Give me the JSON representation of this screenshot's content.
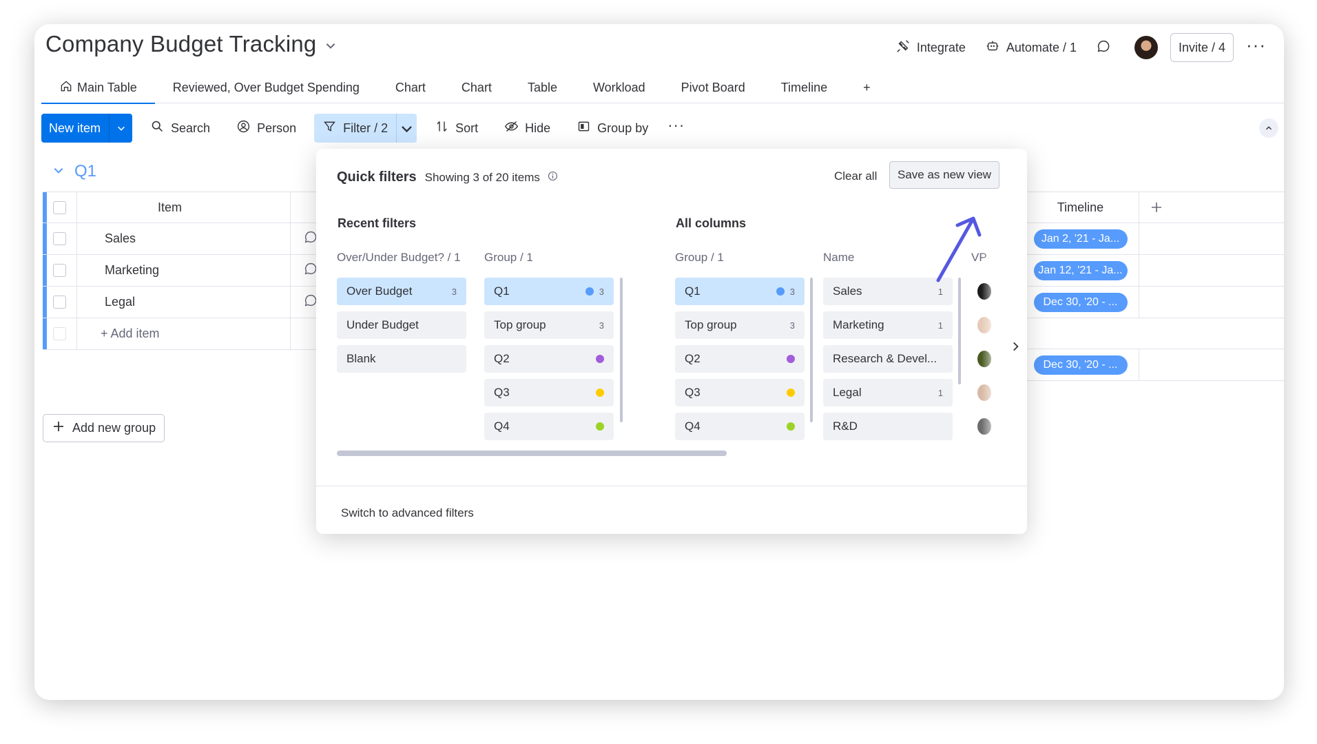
{
  "board": {
    "title": "Company Budget Tracking"
  },
  "header": {
    "integrate": "Integrate",
    "automate": "Automate / 1",
    "invite": "Invite / 4"
  },
  "tabs": [
    {
      "label": "Main Table",
      "icon": "home-icon",
      "active": true
    },
    {
      "label": "Reviewed, Over Budget Spending"
    },
    {
      "label": "Chart"
    },
    {
      "label": "Chart"
    },
    {
      "label": "Table"
    },
    {
      "label": "Workload"
    },
    {
      "label": "Pivot Board"
    },
    {
      "label": "Timeline"
    },
    {
      "label": "+"
    }
  ],
  "toolbar": {
    "new_item": "New item",
    "search": "Search",
    "person": "Person",
    "filter": "Filter / 2",
    "sort": "Sort",
    "hide": "Hide",
    "group_by": "Group by"
  },
  "group": {
    "title": "Q1",
    "item_header": "Item",
    "timeline_header": "Timeline",
    "rows": [
      {
        "name": "Sales",
        "timeline": "Jan 2, '21 - Ja..."
      },
      {
        "name": "Marketing",
        "timeline": "Jan 12, '21 - Ja..."
      },
      {
        "name": "Legal",
        "timeline": "Dec 30, '20 - ..."
      }
    ],
    "add_item": "+ Add item",
    "extra_timeline": "Dec 30, '20 - ..."
  },
  "add_group": "Add new group",
  "filter_popover": {
    "title": "Quick filters",
    "showing": "Showing 3 of 20 items",
    "clear_all": "Clear all",
    "save_view": "Save as new view",
    "recent_title": "Recent filters",
    "all_title": "All columns",
    "switch_advanced": "Switch to advanced filters",
    "recent_columns": [
      {
        "title": "Over/Under Budget? / 1",
        "options": [
          {
            "label": "Over Budget",
            "count": "3",
            "selected": true
          },
          {
            "label": "Under Budget"
          },
          {
            "label": "Blank"
          }
        ]
      },
      {
        "title": "Group / 1",
        "options": [
          {
            "label": "Q1",
            "count": "3",
            "dot": "#579bfc",
            "selected": true
          },
          {
            "label": "Top group",
            "count": "3"
          },
          {
            "label": "Q2",
            "dot": "#a25ddc"
          },
          {
            "label": "Q3",
            "dot": "#ffcb00"
          },
          {
            "label": "Q4",
            "dot": "#9cd326"
          }
        ]
      }
    ],
    "all_columns": [
      {
        "title": "Group / 1",
        "options": [
          {
            "label": "Q1",
            "count": "3",
            "dot": "#579bfc",
            "selected": true
          },
          {
            "label": "Top group",
            "count": "3"
          },
          {
            "label": "Q2",
            "dot": "#a25ddc"
          },
          {
            "label": "Q3",
            "dot": "#ffcb00"
          },
          {
            "label": "Q4",
            "dot": "#9cd326"
          }
        ]
      },
      {
        "title": "Name",
        "options": [
          {
            "label": "Sales",
            "count": "1"
          },
          {
            "label": "Marketing",
            "count": "1"
          },
          {
            "label": "Research & Devel..."
          },
          {
            "label": "Legal",
            "count": "1"
          },
          {
            "label": "R&D"
          }
        ]
      },
      {
        "title": "VP"
      }
    ]
  },
  "colors": {
    "primary": "#0073ea",
    "group_blue": "#579bfc",
    "selected_bg": "#cce5ff",
    "annotation_arrow": "#5559df"
  }
}
